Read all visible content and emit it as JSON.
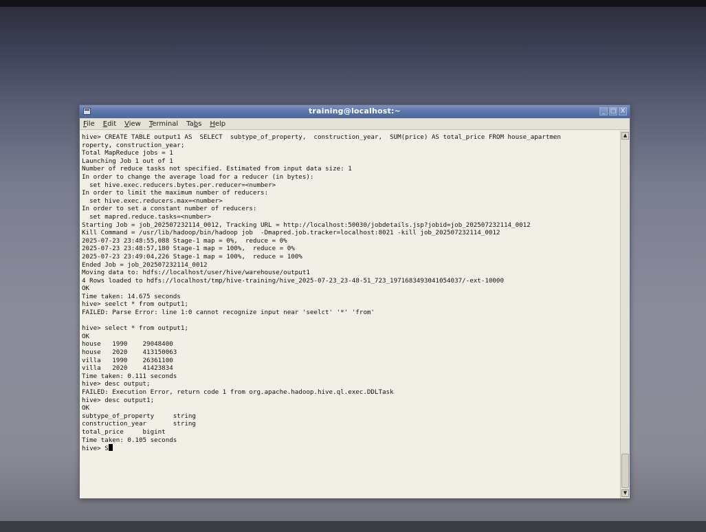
{
  "window": {
    "title": "training@localhost:~",
    "buttons": {
      "minimize": "_",
      "maximize": "□",
      "close": "X"
    },
    "menu_icon": "terminal-menu-icon"
  },
  "menubar": {
    "items": [
      {
        "label": "File",
        "mnemonic": "F",
        "rest": "ile"
      },
      {
        "label": "Edit",
        "mnemonic": "E",
        "rest": "dit"
      },
      {
        "label": "View",
        "mnemonic": "V",
        "rest": "iew"
      },
      {
        "label": "Terminal",
        "mnemonic": "T",
        "rest": "erminal"
      },
      {
        "label": "Tabs",
        "pre": "Ta",
        "mnemonic": "b",
        "rest": "s"
      },
      {
        "label": "Help",
        "mnemonic": "H",
        "rest": "elp"
      }
    ]
  },
  "terminal": {
    "lines": [
      "hive> CREATE TABLE output1 AS  SELECT  subtype_of_property,  construction_year,  SUM(price) AS total_price FROM house_apartmen",
      "roperty, construction_year;",
      "Total MapReduce jobs = 1",
      "Launching Job 1 out of 1",
      "Number of reduce tasks not specified. Estimated from input data size: 1",
      "In order to change the average load for a reducer (in bytes):",
      "  set hive.exec.reducers.bytes.per.reducer=<number>",
      "In order to limit the maximum number of reducers:",
      "  set hive.exec.reducers.max=<number>",
      "In order to set a constant number of reducers:",
      "  set mapred.reduce.tasks=<number>",
      "Starting Job = job_202507232114_0012, Tracking URL = http://localhost:50030/jobdetails.jsp?jobid=job_202507232114_0012",
      "Kill Command = /usr/lib/hadoop/bin/hadoop job  -Dmapred.job.tracker=localhost:8021 -kill job_202507232114_0012",
      "2025-07-23 23:48:55,088 Stage-1 map = 0%,  reduce = 0%",
      "2025-07-23 23:48:57,180 Stage-1 map = 100%,  reduce = 0%",
      "2025-07-23 23:49:04,226 Stage-1 map = 100%,  reduce = 100%",
      "Ended Job = job_202507232114_0012",
      "Moving data to: hdfs://localhost/user/hive/warehouse/output1",
      "4 Rows loaded to hdfs://localhost/tmp/hive-training/hive_2025-07-23_23-48-51_723_1971683493041054037/-ext-10000",
      "OK",
      "Time taken: 14.675 seconds",
      "hive> seelct * from output1;",
      "FAILED: Parse Error: line 1:0 cannot recognize input near 'seelct' '*' 'from'",
      "",
      "hive> select * from output1;",
      "OK",
      "house   1990    29048400",
      "house   2020    413150063",
      "villa   1990    26361100",
      "villa   2020    41423834",
      "Time taken: 0.111 seconds",
      "hive> desc output;",
      "FAILED: Execution Error, return code 1 from org.apache.hadoop.hive.ql.exec.DDLTask",
      "hive> desc output1;",
      "OK",
      "subtype_of_property     string",
      "construction_year       string",
      "total_price     bigint",
      "Time taken: 0.105 seconds"
    ],
    "prompt": "hive> ",
    "current_input": "S"
  },
  "scrollbar": {
    "up_arrow": "▲",
    "down_arrow": "▼"
  }
}
